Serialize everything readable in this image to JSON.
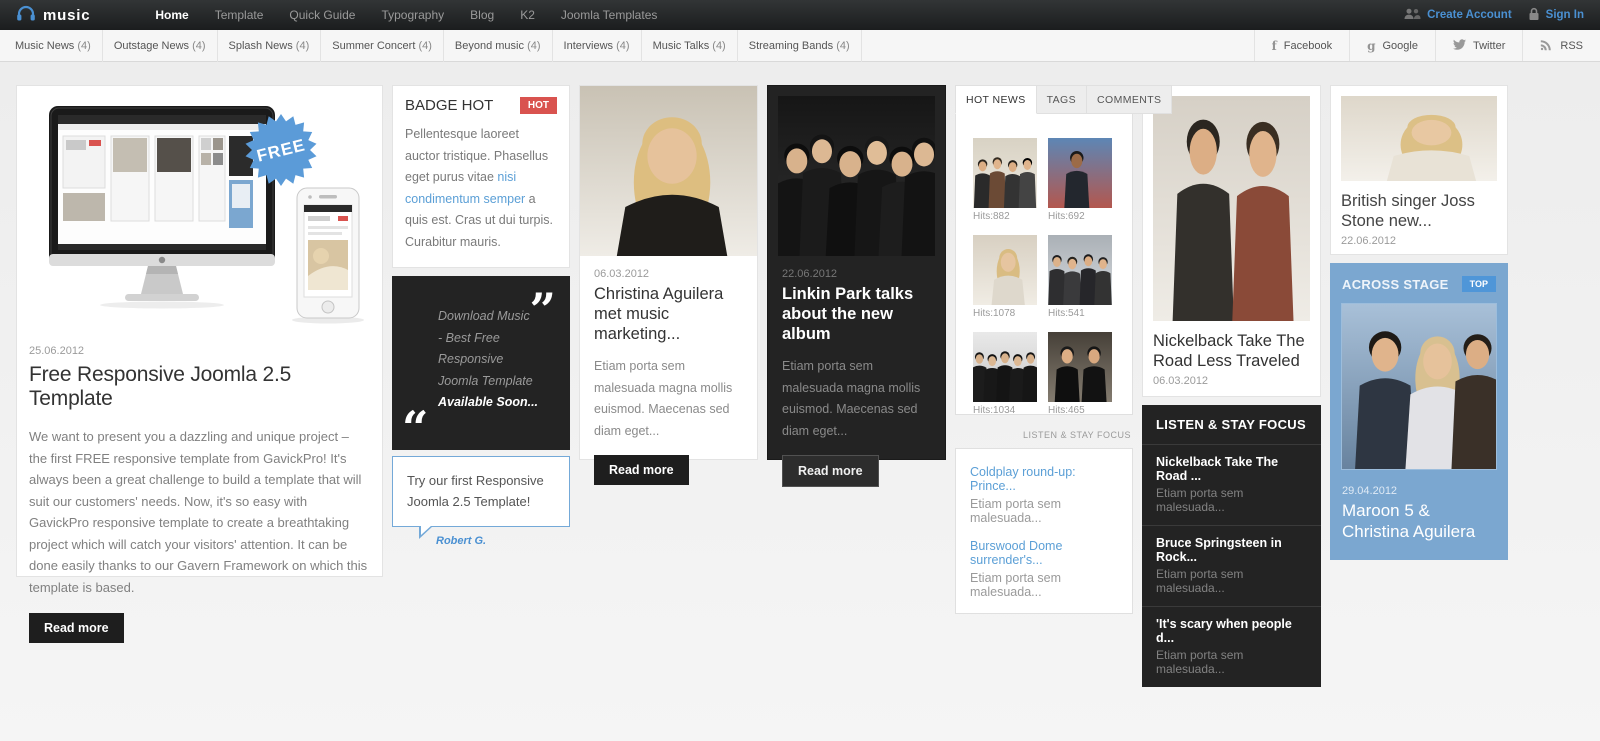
{
  "topnav": {
    "brand": "music",
    "items": [
      {
        "label": "Home"
      },
      {
        "label": "Template"
      },
      {
        "label": "Quick Guide"
      },
      {
        "label": "Typography"
      },
      {
        "label": "Blog"
      },
      {
        "label": "K2"
      },
      {
        "label": "Joomla Templates"
      }
    ],
    "create_account": "Create Account",
    "sign_in": "Sign In"
  },
  "subnav": {
    "categories": [
      {
        "label": "Music News",
        "count": "(4)"
      },
      {
        "label": "Outstage News",
        "count": "(4)"
      },
      {
        "label": "Splash News",
        "count": "(4)"
      },
      {
        "label": "Summer Concert",
        "count": "(4)"
      },
      {
        "label": "Beyond music",
        "count": "(4)"
      },
      {
        "label": "Interviews",
        "count": "(4)"
      },
      {
        "label": "Music Talks",
        "count": "(4)"
      },
      {
        "label": "Streaming Bands",
        "count": "(4)"
      }
    ],
    "social": [
      {
        "label": "Facebook"
      },
      {
        "label": "Google"
      },
      {
        "label": "Twitter"
      },
      {
        "label": "RSS"
      }
    ]
  },
  "feature": {
    "badge": "FREE",
    "date": "25.06.2012",
    "title": "Free Responsive Joomla 2.5 Template",
    "body": "We want to present you a dazzling and unique project – the first FREE responsive template from GavickPro! It's always been a great challenge to build a template that will suit our customers' needs. Now, it's so easy with GavickPro responsive template to create a breathtaking project which will catch your visitors' attention. It can be done easily thanks to our Gavern Framework on which this template is based.",
    "read_more": "Read more"
  },
  "badge_box": {
    "title": "BADGE HOT",
    "badge": "HOT",
    "text_before": "Pellentesque laoreet auctor tristique. Phasellus eget purus vitae ",
    "link": "nisi condimentum semper",
    "text_after": " a quis est. Cras ut dui turpis. Curabitur mauris."
  },
  "quote_dark": {
    "lines": [
      "Download Music",
      "- Best Free",
      "Responsive",
      "Joomla Template"
    ],
    "highlight": "Available Soon...",
    "open_quote": "“",
    "close_quote": "”"
  },
  "quote_light": {
    "line1": "Try our first Responsive",
    "line2": "Joomla 2.5 Template!",
    "author": "Robert G."
  },
  "article_christina": {
    "date": "06.03.2012",
    "title": "Christina Aguilera met music marketing...",
    "body": "Etiam porta sem malesuada magna mollis euismod. Maecenas sed diam eget...",
    "read_more": "Read more"
  },
  "article_linkin": {
    "date": "22.06.2012",
    "title": "Linkin Park talks about the new album",
    "body": "Etiam porta sem malesuada magna mollis euismod. Maecenas sed diam eget...",
    "read_more": "Read more"
  },
  "hot_news": {
    "tabs": [
      {
        "label": "HOT NEWS"
      },
      {
        "label": "TAGS"
      },
      {
        "label": "COMMENTS"
      }
    ],
    "active_tab": "HOT NEWS",
    "thumbs": [
      {
        "hits": "Hits:882"
      },
      {
        "hits": "Hits:692"
      },
      {
        "hits": "Hits:1078"
      },
      {
        "hits": "Hits:541"
      },
      {
        "hits": "Hits:1034"
      },
      {
        "hits": "Hits:465"
      }
    ]
  },
  "listen_light": {
    "label": "LISTEN & STAY FOCUS",
    "items": [
      {
        "title": "Coldplay round-up: Prince...",
        "excerpt": "Etiam porta sem malesuada..."
      },
      {
        "title": "Burswood Dome surrender's...",
        "excerpt": "Etiam porta sem malesuada..."
      }
    ]
  },
  "article_nickelback": {
    "title": "Nickelback Take The Road Less Traveled",
    "date": "06.03.2012"
  },
  "listen_dark": {
    "title": "LISTEN & STAY FOCUS",
    "items": [
      {
        "title": "Nickelback Take The Road ...",
        "excerpt": "Etiam porta sem malesuada..."
      },
      {
        "title": "Bruce Springsteen in Rock...",
        "excerpt": "Etiam porta sem malesuada..."
      },
      {
        "title": "'It's scary when people d...",
        "excerpt": "Etiam porta sem malesuada..."
      }
    ]
  },
  "article_joss": {
    "title": "British singer Joss Stone new...",
    "date": "22.06.2012"
  },
  "across_stage": {
    "title": "ACROSS STAGE",
    "badge": "TOP",
    "date": "29.04.2012",
    "item_title": "Maroon 5 & Christina Aguilera"
  },
  "colors": {
    "accent_blue": "#4a90d2",
    "hot_red": "#d9534f",
    "across_blue": "#7ba7d0",
    "top_badge_blue": "#4f96d8",
    "dark_card": "#232323"
  }
}
